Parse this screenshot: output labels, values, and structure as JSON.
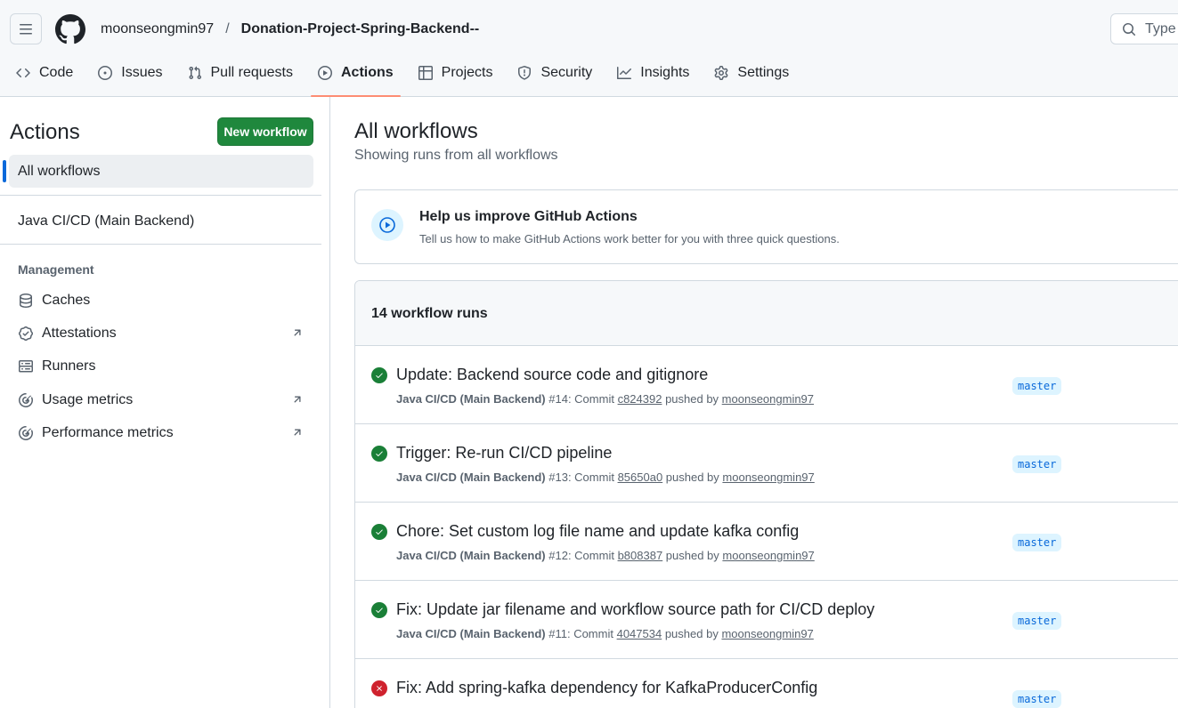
{
  "header": {
    "owner": "moonseongmin97",
    "separator": "/",
    "repo": "Donation-Project-Spring-Backend--",
    "search_placeholder": "Type"
  },
  "tabs": [
    {
      "label": "Code",
      "icon": "code-icon"
    },
    {
      "label": "Issues",
      "icon": "issue-opened-icon"
    },
    {
      "label": "Pull requests",
      "icon": "git-pull-request-icon"
    },
    {
      "label": "Actions",
      "icon": "play-icon",
      "selected": true
    },
    {
      "label": "Projects",
      "icon": "table-icon"
    },
    {
      "label": "Security",
      "icon": "shield-icon"
    },
    {
      "label": "Insights",
      "icon": "graph-icon"
    },
    {
      "label": "Settings",
      "icon": "gear-icon"
    }
  ],
  "sidebar": {
    "title": "Actions",
    "new_workflow_label": "New workflow",
    "all_workflows_label": "All workflows",
    "workflows": [
      "Java CI/CD (Main Backend)"
    ],
    "management_heading": "Management",
    "management_items": [
      {
        "label": "Caches",
        "icon": "database-icon",
        "external": false
      },
      {
        "label": "Attestations",
        "icon": "verified-icon",
        "external": true
      },
      {
        "label": "Runners",
        "icon": "server-icon",
        "external": false
      },
      {
        "label": "Usage metrics",
        "icon": "meter-icon",
        "external": true
      },
      {
        "label": "Performance metrics",
        "icon": "meter-icon",
        "external": true
      }
    ]
  },
  "main": {
    "title": "All workflows",
    "subtitle": "Showing runs from all workflows",
    "feedback": {
      "title": "Help us improve GitHub Actions",
      "description": "Tell us how to make GitHub Actions work better for you with three quick questions."
    },
    "runs_count": "14 workflow runs",
    "runs": [
      {
        "status": "success",
        "title": "Update: Backend source code and gitignore",
        "workflow": "Java CI/CD (Main Backend)",
        "number": "#14",
        "commit_prefix": ": Commit ",
        "commit": "c824392",
        "pushed_by": " pushed by ",
        "actor": "moonseongmin97",
        "branch": "master"
      },
      {
        "status": "success",
        "title": "Trigger: Re-run CI/CD pipeline",
        "workflow": "Java CI/CD (Main Backend)",
        "number": "#13",
        "commit_prefix": ": Commit ",
        "commit": "85650a0",
        "pushed_by": " pushed by ",
        "actor": "moonseongmin97",
        "branch": "master"
      },
      {
        "status": "success",
        "title": "Chore: Set custom log file name and update kafka config",
        "workflow": "Java CI/CD (Main Backend)",
        "number": "#12",
        "commit_prefix": ": Commit ",
        "commit": "b808387",
        "pushed_by": " pushed by ",
        "actor": "moonseongmin97",
        "branch": "master"
      },
      {
        "status": "success",
        "title": "Fix: Update jar filename and workflow source path for CI/CD deploy",
        "workflow": "Java CI/CD (Main Backend)",
        "number": "#11",
        "commit_prefix": ": Commit ",
        "commit": "4047534",
        "pushed_by": " pushed by ",
        "actor": "moonseongmin97",
        "branch": "master"
      },
      {
        "status": "failure",
        "title": "Fix: Add spring-kafka dependency for KafkaProducerConfig",
        "workflow": "",
        "number": "",
        "commit_prefix": "",
        "commit": "",
        "pushed_by": "",
        "actor": "",
        "branch": "master"
      }
    ]
  }
}
